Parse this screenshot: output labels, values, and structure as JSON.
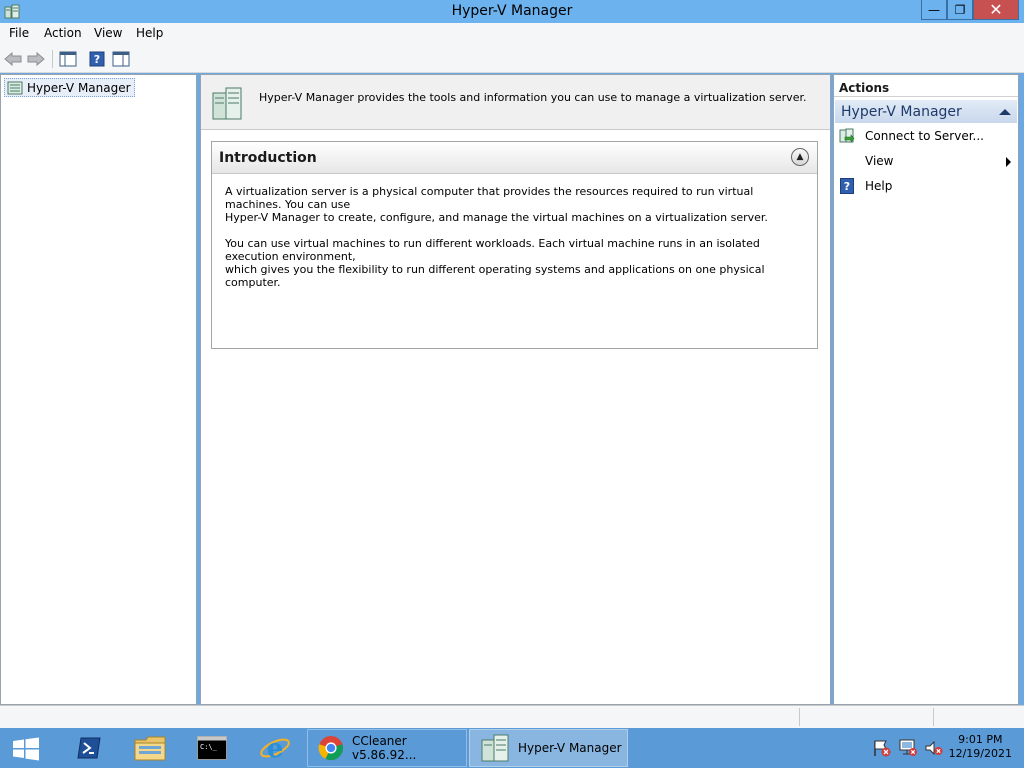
{
  "window": {
    "title": "Hyper-V Manager",
    "minimize_label": "—",
    "restore_label": "❐",
    "close_label": "✕"
  },
  "menu": {
    "items": [
      {
        "label": "File"
      },
      {
        "label": "Action"
      },
      {
        "label": "View"
      },
      {
        "label": "Help"
      }
    ]
  },
  "tree": {
    "root_label": "Hyper-V Manager"
  },
  "center": {
    "description": "Hyper-V Manager provides the tools and information you can use to manage a virtualization server.",
    "intro": {
      "title": "Introduction",
      "paragraph1_line1": "A virtualization server is a physical computer that provides the resources required to run virtual machines. You can use",
      "paragraph1_line2": "Hyper-V Manager to create, configure, and manage the virtual machines on a virtualization server.",
      "paragraph2_line1": "You can use virtual machines to run different workloads. Each virtual machine runs in an isolated execution environment,",
      "paragraph2_line2": "which gives you the flexibility to run different operating systems and applications on one physical computer."
    }
  },
  "actions": {
    "header": "Actions",
    "section_title": "Hyper-V Manager",
    "items": [
      {
        "label": "Connect to Server...",
        "icon": "connect-server-icon"
      },
      {
        "label": "View",
        "icon": "none",
        "has_submenu": true
      },
      {
        "label": "Help",
        "icon": "help-icon"
      }
    ]
  },
  "taskbar": {
    "tasks": [
      {
        "label": "CCleaner v5.86.92...",
        "icon": "chrome-icon"
      },
      {
        "label": "Hyper-V Manager",
        "icon": "hyperv-icon",
        "active": true
      }
    ],
    "clock_time": "9:01 PM",
    "clock_date": "12/19/2021"
  },
  "colors": {
    "titlebar": "#6cb2ee",
    "taskbar": "#5a9ad6",
    "close_button": "#c75050",
    "section_header_text": "#1e3a6b"
  }
}
